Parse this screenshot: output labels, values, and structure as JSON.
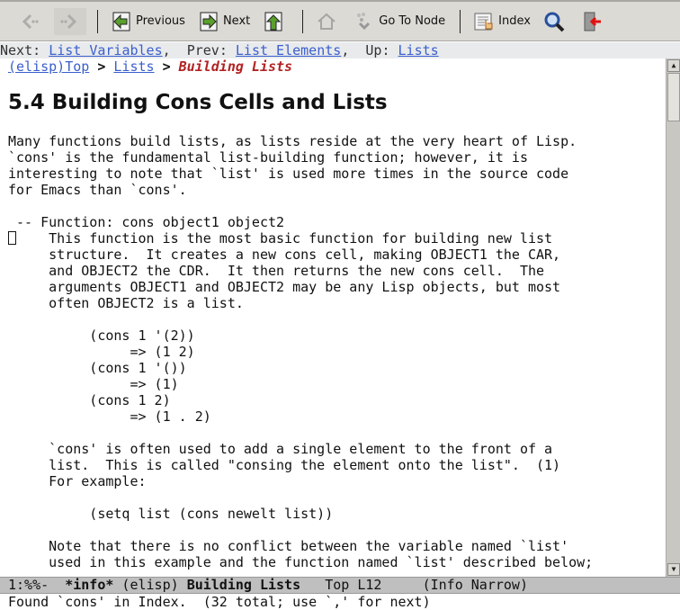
{
  "toolbar": {
    "back": "back-icon",
    "forward": "forward-icon",
    "previous": "Previous",
    "next": "Next",
    "up": "up-icon",
    "home": "home-icon",
    "goto": "Go To Node",
    "index": "Index",
    "search": "search-icon",
    "exit": "exit-icon"
  },
  "header": {
    "next_label": "Next:",
    "next_link": "List Variables",
    "prev_label": "Prev:",
    "prev_link": "List Elements",
    "up_label": "Up:",
    "up_link": "Lists"
  },
  "breadcrumb": {
    "top": "(elisp)Top",
    "lists": "Lists",
    "sep": ">",
    "current": "Building Lists"
  },
  "title": "5.4 Building Cons Cells and Lists",
  "lines": [
    "Many functions build lists, as lists reside at the very heart of Lisp.",
    "`cons' is the fundamental list-building function; however, it is",
    "interesting to note that `list' is used more times in the source code",
    "for Emacs than `cons'.",
    "",
    " -- Function: cons object1 object2",
    "     This function is the most basic function for building new list",
    "     structure.  It creates a new cons cell, making OBJECT1 the CAR,",
    "     and OBJECT2 the CDR.  It then returns the new cons cell.  The",
    "     arguments OBJECT1 and OBJECT2 may be any Lisp objects, but most",
    "     often OBJECT2 is a list.",
    "",
    "          (cons 1 '(2))",
    "               => (1 2)",
    "          (cons 1 '())",
    "               => (1)",
    "          (cons 1 2)",
    "               => (1 . 2)",
    "",
    "     `cons' is often used to add a single element to the front of a",
    "     list.  This is called \"consing the element onto the list\".  (1)",
    "     For example:",
    "",
    "          (setq list (cons newelt list))",
    "",
    "     Note that there is no conflict between the variable named `list'",
    "     used in this example and the function named `list' described below;"
  ],
  "modeline": {
    "status": "1:%%-  ",
    "buffer": "*info*",
    "file": " (elisp) ",
    "node": "Building Lists",
    "pos": "   Top L12     ",
    "mode": "(Info Narrow)"
  },
  "echo": "Found `cons' in Index.  (32 total; use `,' for next)"
}
